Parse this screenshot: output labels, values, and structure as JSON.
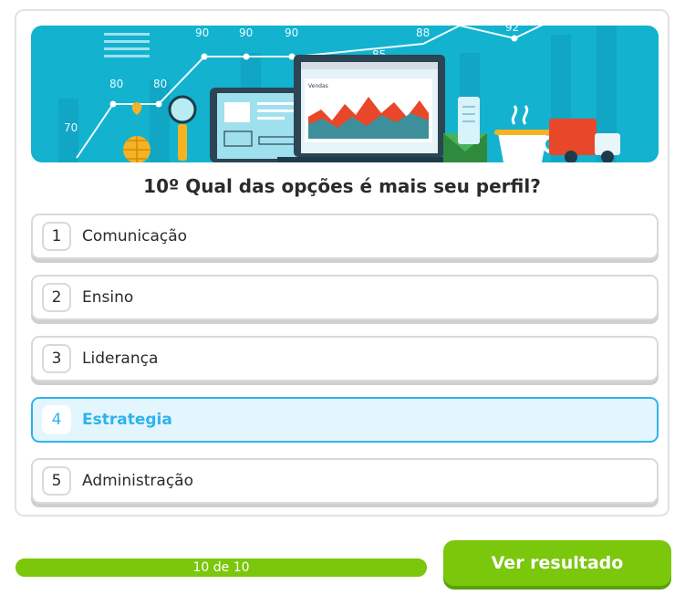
{
  "banner": {
    "numbers": [
      "70",
      "80",
      "80",
      "90",
      "90",
      "90",
      "85",
      "88",
      "92"
    ],
    "screen_label": "Vendas"
  },
  "question": {
    "title": "10º Qual das opções é mais seu perfil?"
  },
  "options": [
    {
      "number": "1",
      "label": "Comunicação",
      "selected": false
    },
    {
      "number": "2",
      "label": "Ensino",
      "selected": false
    },
    {
      "number": "3",
      "label": "Liderança",
      "selected": false
    },
    {
      "number": "4",
      "label": "Estrategia",
      "selected": true
    },
    {
      "number": "5",
      "label": "Administração",
      "selected": false
    }
  ],
  "progress": {
    "text": "10 de 10",
    "value": 1.0
  },
  "result_button": {
    "label": "Ver resultado"
  },
  "colors": {
    "accent_green": "#7ac70c",
    "selected_blue": "#2fb3ea",
    "banner_teal": "#13b2cf"
  }
}
